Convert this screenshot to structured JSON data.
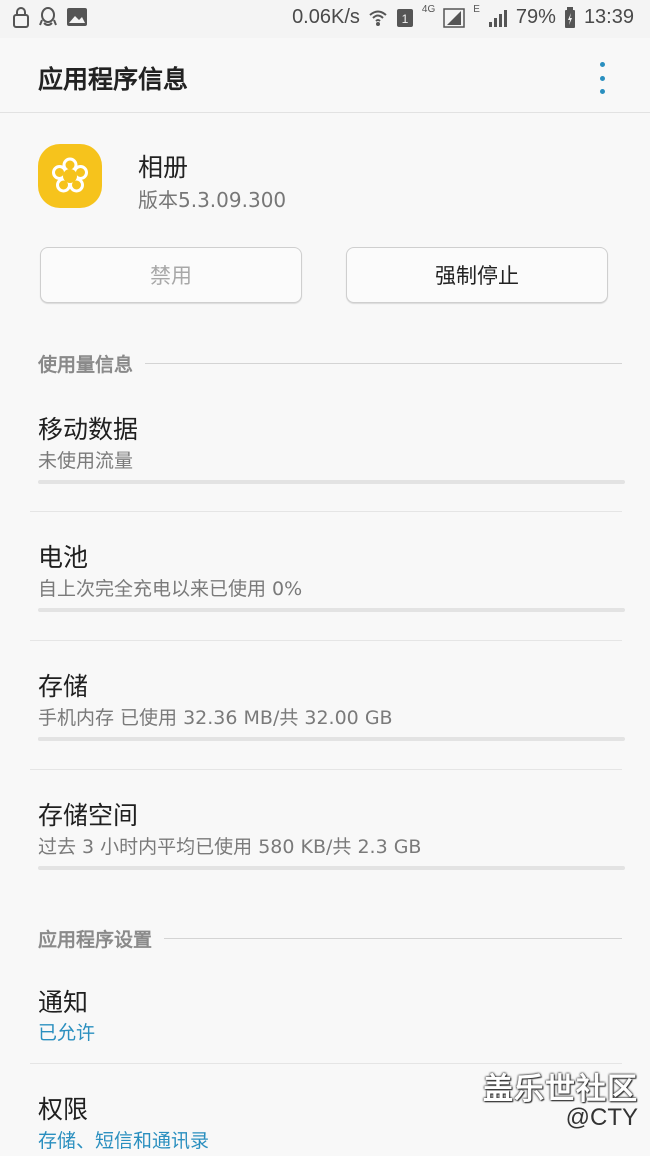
{
  "status_bar": {
    "speed": "0.06K/s",
    "sim_badge": "1",
    "network_4g": "4G",
    "network_e": "E",
    "battery": "79%",
    "time": "13:39",
    "icons": [
      "lock-icon",
      "qq-icon",
      "image-icon",
      "wifi-icon",
      "sim-icon",
      "signal-icon",
      "battery-icon"
    ]
  },
  "app_bar": {
    "title": "应用程序信息",
    "more_icon": "more-vert-icon",
    "accent_color": "#2a8fbf"
  },
  "app": {
    "name": "相册",
    "version": "版本5.3.09.300",
    "icon": "gallery-flower-icon",
    "icon_color": "#f6c31c"
  },
  "buttons": {
    "disable": "禁用",
    "force_stop": "强制停止"
  },
  "usage_section": {
    "header": "使用量信息",
    "items": [
      {
        "title": "移动数据",
        "subtitle": "未使用流量",
        "usage_fraction": 0
      },
      {
        "title": "电池",
        "subtitle": "自上次完全充电以来已使用 0%",
        "usage_fraction": 0
      },
      {
        "title": "存储",
        "subtitle": "手机内存 已使用 32.36 MB/共 32.00 GB",
        "usage_fraction": 0.001
      },
      {
        "title": "存储空间",
        "subtitle": "过去 3 小时内平均已使用 580 KB/共 2.3 GB",
        "usage_fraction": 0
      }
    ]
  },
  "settings_section": {
    "header": "应用程序设置",
    "items": [
      {
        "title": "通知",
        "subtitle": "已允许"
      },
      {
        "title": "权限",
        "subtitle": "存储、短信和通讯录"
      }
    ]
  },
  "watermark": {
    "main": "盖乐世社区",
    "sub": "@CTY"
  }
}
